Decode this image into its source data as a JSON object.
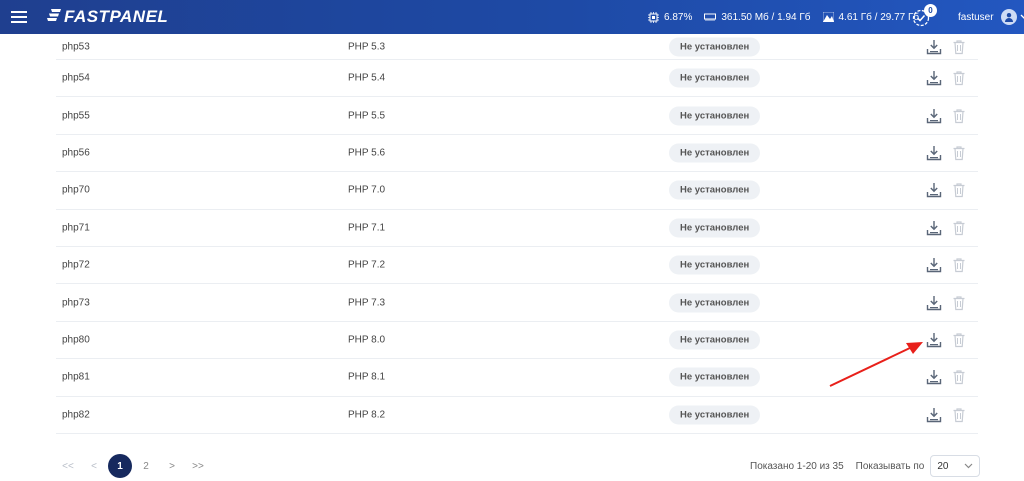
{
  "header": {
    "logo_text": "FASTPANEL",
    "cpu": "6.87%",
    "ram": "361.50 Мб / 1.94 Гб",
    "disk": "4.61 Гб / 29.77 Гб",
    "notifications_count": "0",
    "username": "fastuser"
  },
  "table": {
    "rows": [
      {
        "name": "php53",
        "version": "PHP 5.3",
        "status": "Не установлен"
      },
      {
        "name": "php54",
        "version": "PHP 5.4",
        "status": "Не установлен"
      },
      {
        "name": "php55",
        "version": "PHP 5.5",
        "status": "Не установлен"
      },
      {
        "name": "php56",
        "version": "PHP 5.6",
        "status": "Не установлен"
      },
      {
        "name": "php70",
        "version": "PHP 7.0",
        "status": "Не установлен"
      },
      {
        "name": "php71",
        "version": "PHP 7.1",
        "status": "Не установлен"
      },
      {
        "name": "php72",
        "version": "PHP 7.2",
        "status": "Не установлен"
      },
      {
        "name": "php73",
        "version": "PHP 7.3",
        "status": "Не установлен"
      },
      {
        "name": "php80",
        "version": "PHP 8.0",
        "status": "Не установлен"
      },
      {
        "name": "php81",
        "version": "PHP 8.1",
        "status": "Не установлен"
      },
      {
        "name": "php82",
        "version": "PHP 8.2",
        "status": "Не установлен"
      }
    ]
  },
  "pagination": {
    "first": "<<",
    "prev": "<",
    "pages": [
      "1",
      "2"
    ],
    "next": ">",
    "last": ">>",
    "showing": "Показано 1-20 из 35",
    "per_page_label": "Показывать по",
    "per_page_value": "20"
  },
  "colors": {
    "header_bg": "#1e4aa6",
    "active_page": "#16295e",
    "annotation_arrow": "#e8201a"
  }
}
